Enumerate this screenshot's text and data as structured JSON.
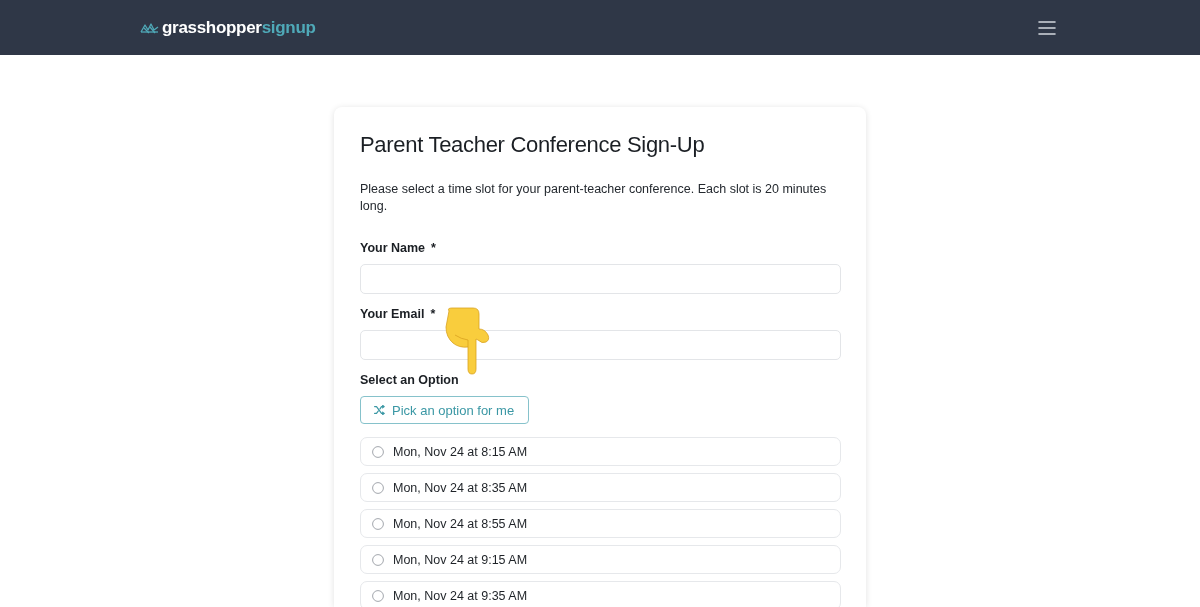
{
  "header": {
    "logo": {
      "name": "grasshopper",
      "suffix": "signup"
    }
  },
  "form": {
    "title": "Parent Teacher Conference Sign-Up",
    "description": "Please select a time slot for your parent-teacher conference. Each slot is 20 minutes long.",
    "fields": [
      {
        "label": "Your Name",
        "required_mark": "*"
      },
      {
        "label": "Your Email",
        "required_mark": "*"
      }
    ],
    "options_label": "Select an Option",
    "random_button": "Pick an option for me",
    "options": [
      {
        "label": "Mon, Nov 24 at 8:15 AM",
        "selected": false
      },
      {
        "label": "Mon, Nov 24 at 8:35 AM",
        "selected": false
      },
      {
        "label": "Mon, Nov 24 at 8:55 AM",
        "selected": false
      },
      {
        "label": "Mon, Nov 24 at 9:15 AM",
        "selected": false
      },
      {
        "label": "Mon, Nov 24 at 9:35 AM",
        "selected": false
      }
    ]
  }
}
